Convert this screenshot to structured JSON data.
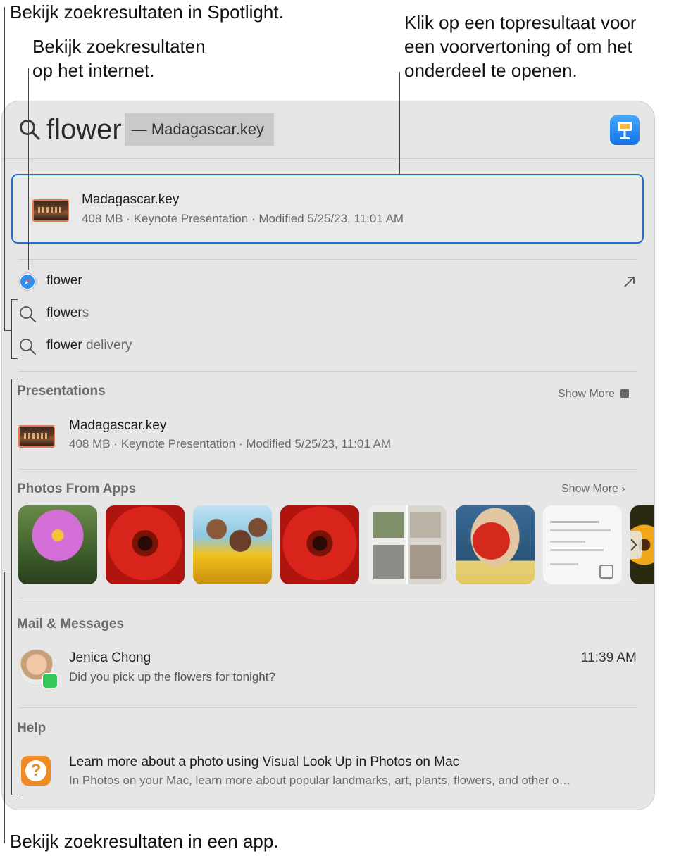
{
  "callouts": {
    "spotlight": "Bekijk zoekresultaten in Spotlight.",
    "internet_line1": "Bekijk zoekresultaten",
    "internet_line2": "op het internet.",
    "tophit_line1": "Klik op een topresultaat voor",
    "tophit_line2": "een voorvertoning of om het",
    "tophit_line3": "onderdeel te openen.",
    "app": "Bekijk zoekresultaten in een app."
  },
  "search": {
    "query": "flower",
    "completion": "— Madagascar.key",
    "app_icon": "keynote-icon"
  },
  "top_hit": {
    "title": "Madagascar.key",
    "subtitle": "408 MB · Keynote Presentation · Modified 5/25/23, 11:01 AM"
  },
  "suggestions": [
    {
      "icon": "safari-icon",
      "text": "flower",
      "suffix": "",
      "action_icon": "arrow-up-right-icon"
    },
    {
      "icon": "search-icon",
      "text": "flower",
      "suffix": "s"
    },
    {
      "icon": "search-icon",
      "text": "flower",
      "suffix": " delivery"
    }
  ],
  "presentations": {
    "header": "Presentations",
    "show_more": "Show More",
    "item": {
      "title": "Madagascar.key",
      "subtitle": "408 MB · Keynote Presentation · Modified 5/25/23, 11:01 AM"
    }
  },
  "photos": {
    "header": "Photos From Apps",
    "show_more": "Show More ›",
    "tiles": [
      "pink-flower-photo",
      "red-gerbera-photo",
      "friends-sunflowers-photo",
      "red-gerbera-photo",
      "interior-collage-photo",
      "person-with-flower-photo",
      "document-scan-photo",
      "sunflower-photo"
    ]
  },
  "mail": {
    "header": "Mail & Messages",
    "sender": "Jenica Chong",
    "time": "11:39 AM",
    "preview": "Did you pick up the flowers for tonight?"
  },
  "help": {
    "header": "Help",
    "title": "Learn more about a photo using Visual Look Up in Photos on Mac",
    "subtitle": "In Photos on your Mac, learn more about popular landmarks, art, plants, flowers, and other o…"
  },
  "colors": {
    "accent": "#1f6ed4",
    "panel": "#e6e6e6",
    "help_orange": "#f08a24",
    "messages_green": "#34c759"
  }
}
